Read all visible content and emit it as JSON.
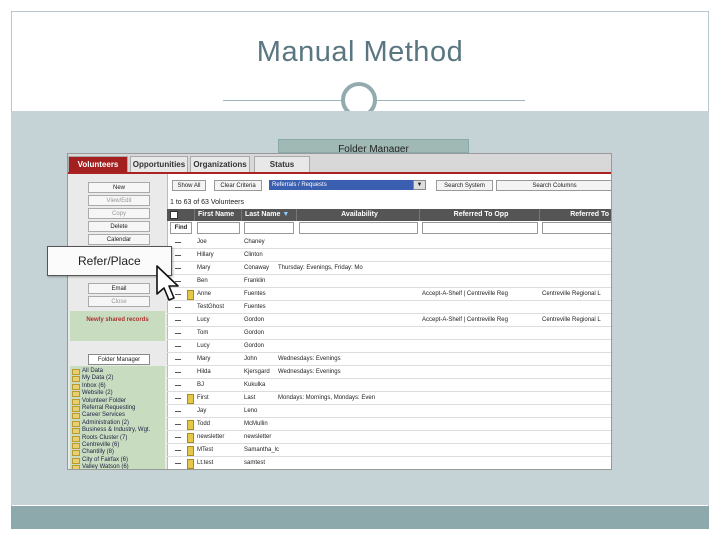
{
  "slide": {
    "title": "Manual Method",
    "colors": {
      "title": "#5a7680",
      "content_bg": "#c5d3d6",
      "footer_bg": "#8ea9ac",
      "accent_tab": "#a42020"
    }
  },
  "screenshot": {
    "folder_manager_label": "Folder Manager",
    "tabs": [
      "Volunteers",
      "Opportunities",
      "Organizations",
      "Status"
    ],
    "sidebar_buttons": [
      "New",
      "View/Edit",
      "Copy",
      "Delete",
      "Calendar",
      "Email",
      "Close"
    ],
    "refer_button": "Refer/Place",
    "newly_shared": "Newly shared records",
    "folder_manager_button": "Folder Manager",
    "folders": [
      "All Data",
      "My Data (2)",
      "Inbox (6)",
      "Website (2)",
      "Volunteer Folder",
      "Referral Requesting",
      "Career Services",
      "Administration (2)",
      "Business & Industry, Wgt.",
      "Roots Cluster (7)",
      "Centreville (6)",
      "Chantilly (8)",
      "City of Fairfax (6)",
      "Valley Watson (6)"
    ],
    "toolbar": {
      "show_all": "Show All",
      "clear_criteria": "Clear Criteria",
      "referral_select": "Referrals / Requests",
      "search_system": "Search System",
      "search_columns": "Search Columns"
    },
    "range_text": "1 to 63 of 63 Volunteers",
    "columns": [
      "First Name",
      "Last Name",
      "Availability",
      "Referred To Opp",
      "Referred To"
    ],
    "find_label": "Find",
    "rows": [
      {
        "first": "Joe",
        "last": "Chaney",
        "avail": "",
        "opp": "",
        "org": ""
      },
      {
        "first": "Hillary",
        "last": "Clinton",
        "avail": "",
        "opp": "",
        "org": ""
      },
      {
        "first": "Mary",
        "last": "Conaway",
        "avail": "Thursday: Evenings, Friday: Mo",
        "opp": "",
        "org": ""
      },
      {
        "first": "Ben",
        "last": "Franklin",
        "avail": "",
        "opp": "",
        "org": ""
      },
      {
        "first": "Anne",
        "last": "Fuentes",
        "avail": "",
        "opp": "Accept-A-Shelf | Centreville Reg",
        "org": "Centreville Regional L"
      },
      {
        "first": "TestGhost",
        "last": "Fuentes",
        "avail": "",
        "opp": "",
        "org": ""
      },
      {
        "first": "Lucy",
        "last": "Gordon",
        "avail": "",
        "opp": "Accept-A-Shelf | Centreville Reg",
        "org": "Centreville Regional L"
      },
      {
        "first": "Tom",
        "last": "Gordon",
        "avail": "",
        "opp": "",
        "org": ""
      },
      {
        "first": "Lucy",
        "last": "Gordon",
        "avail": "",
        "opp": "",
        "org": ""
      },
      {
        "first": "Mary",
        "last": "John",
        "avail": "Wednesdays: Evenings",
        "opp": "",
        "org": ""
      },
      {
        "first": "Hilda",
        "last": "Kjersgard",
        "avail": "Wednesdays: Evenings",
        "opp": "",
        "org": ""
      },
      {
        "first": "BJ",
        "last": "Kukulka",
        "avail": "",
        "opp": "",
        "org": ""
      },
      {
        "first": "First",
        "last": "Last",
        "avail": "Mondays: Mornings, Mondays: Even",
        "opp": "",
        "org": ""
      },
      {
        "first": "Jay",
        "last": "Leno",
        "avail": "",
        "opp": "",
        "org": ""
      },
      {
        "first": "Todd",
        "last": "McMullin",
        "avail": "",
        "opp": "",
        "org": ""
      },
      {
        "first": "newsletter",
        "last": "newsletter",
        "avail": "",
        "opp": "",
        "org": ""
      },
      {
        "first": "MTest",
        "last": "Samantha_lc",
        "avail": "",
        "opp": "",
        "org": ""
      },
      {
        "first": "Lt.test",
        "last": "samtest",
        "avail": "",
        "opp": "",
        "org": ""
      }
    ]
  }
}
